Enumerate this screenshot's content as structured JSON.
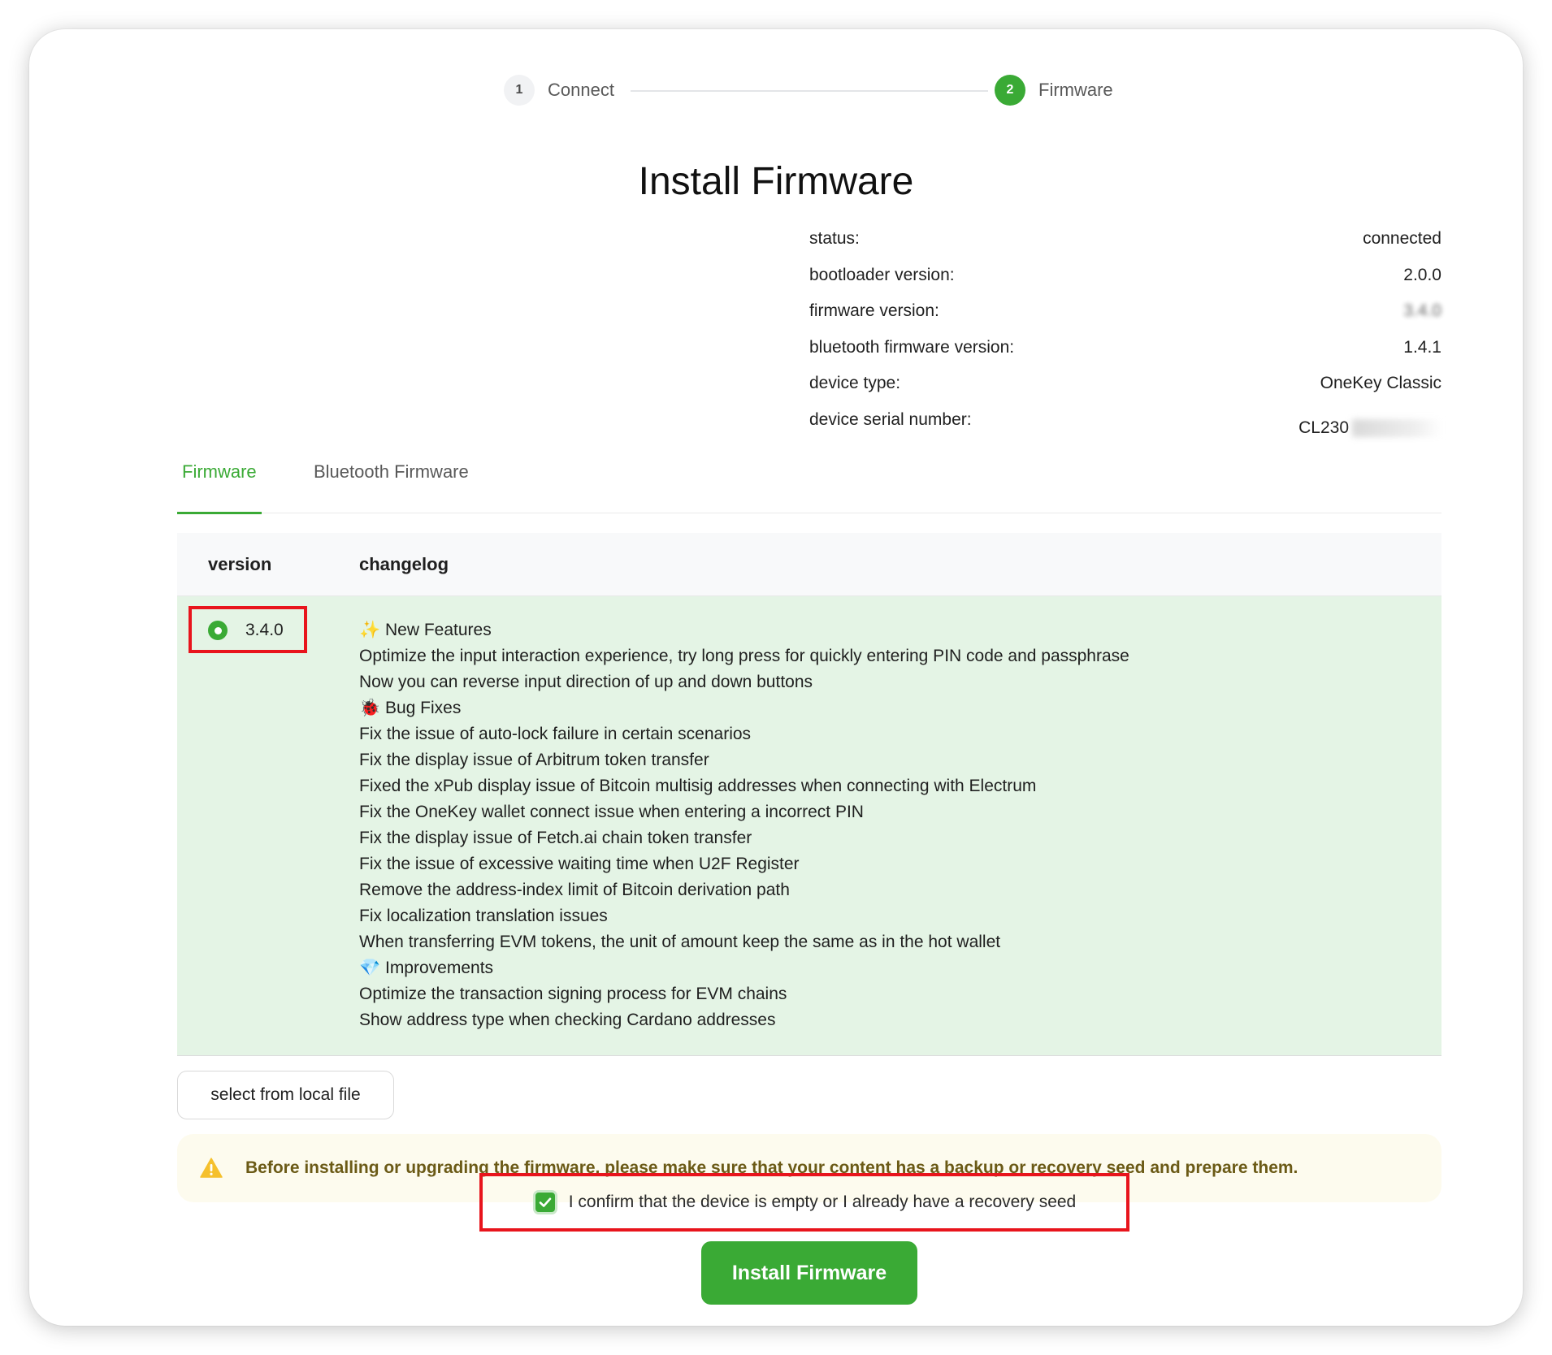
{
  "stepper": {
    "steps": [
      {
        "number": "1",
        "label": "Connect"
      },
      {
        "number": "2",
        "label": "Firmware"
      }
    ]
  },
  "page": {
    "title": "Install Firmware"
  },
  "device_info": {
    "rows": [
      {
        "label": "status:",
        "value": "connected"
      },
      {
        "label": "bootloader version:",
        "value": "2.0.0"
      },
      {
        "label": "firmware version:",
        "value": "3.4.0"
      },
      {
        "label": "bluetooth firmware version:",
        "value": "1.4.1"
      },
      {
        "label": "device type:",
        "value": "OneKey Classic"
      },
      {
        "label": "device serial number:",
        "value": "CL230"
      }
    ]
  },
  "tabs": [
    {
      "label": "Firmware",
      "active": true
    },
    {
      "label": "Bluetooth Firmware",
      "active": false
    }
  ],
  "table": {
    "headers": {
      "version": "version",
      "changelog": "changelog"
    },
    "rows": [
      {
        "version": "3.4.0",
        "selected": true,
        "changelog": [
          "✨ New Features",
          "Optimize the input interaction experience, try long press for quickly entering PIN code and passphrase",
          "Now you can reverse input direction of up and down buttons",
          "🐞 Bug Fixes",
          "Fix the issue of auto-lock failure in certain scenarios",
          "Fix the display issue of Arbitrum token transfer",
          "Fixed the xPub display issue of Bitcoin multisig addresses when connecting with Electrum",
          "Fix the OneKey wallet connect issue when entering a incorrect PIN",
          "Fix the display issue of Fetch.ai chain token transfer",
          "Fix the issue of excessive waiting time when U2F Register",
          "Remove the address-index limit of Bitcoin derivation path",
          "Fix localization translation issues",
          "When transferring EVM tokens, the unit of amount keep the same as in the hot wallet",
          "💎 Improvements",
          "Optimize the transaction signing process for EVM chains",
          "Show address type when checking Cardano addresses"
        ]
      }
    ]
  },
  "local_file_button": "select from local file",
  "warning": {
    "icon": "warning-triangle-icon",
    "text": "Before installing or upgrading the firmware, please make sure that your content has a backup or recovery seed and prepare them."
  },
  "confirm": {
    "checked": true,
    "text": "I confirm that the device is empty or I already have a recovery seed"
  },
  "install_button": "Install Firmware",
  "colors": {
    "accent": "#3aaa35",
    "highlight": "#e8141c",
    "row_selected_bg": "#e4f4e5",
    "warning_bg": "#fdfbee",
    "warning_text": "#6b5a16"
  }
}
